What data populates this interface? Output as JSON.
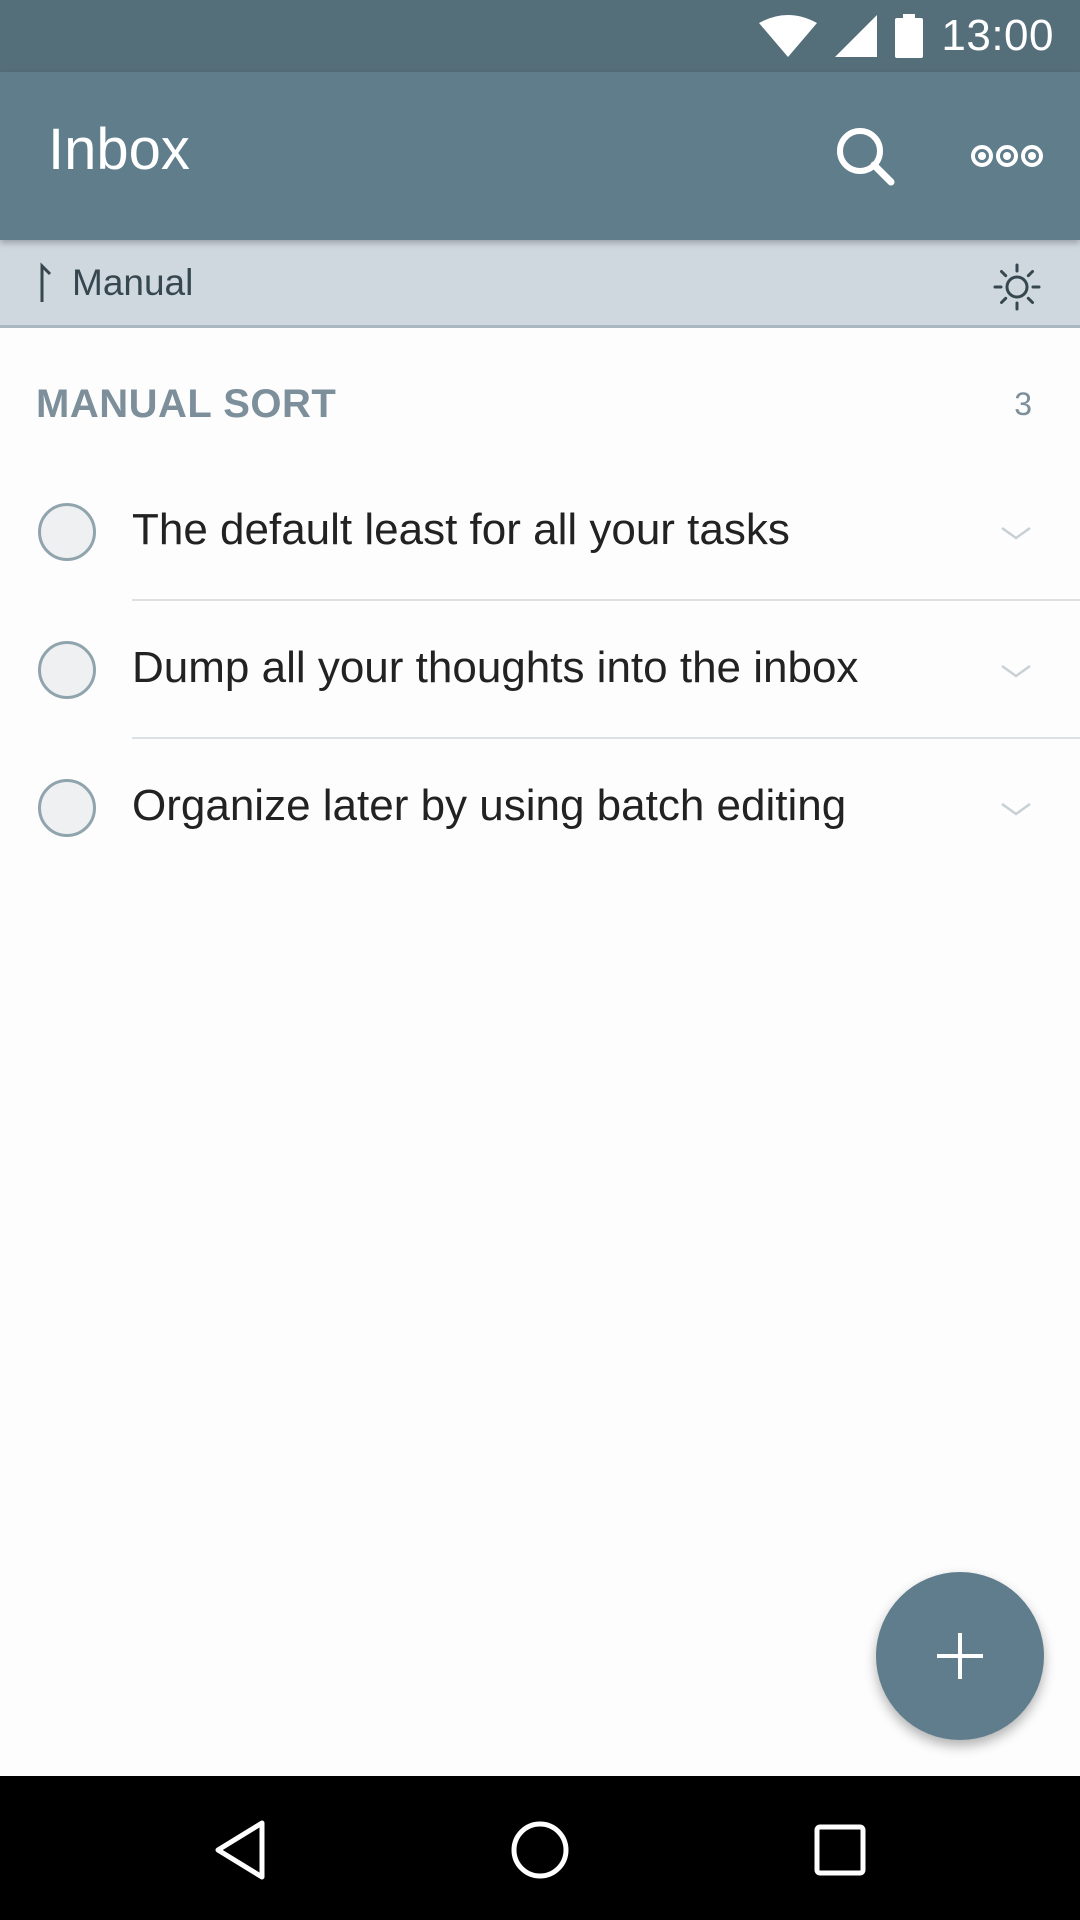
{
  "status_bar": {
    "time": "13:00",
    "icons": [
      "wifi-icon",
      "cell-signal-icon",
      "battery-icon"
    ]
  },
  "app_bar": {
    "title": "Inbox",
    "actions": [
      "search-icon",
      "more-options-icon"
    ]
  },
  "sort_bar": {
    "label": "Manual",
    "icons": [
      "sort-icon",
      "theme-sun-icon"
    ]
  },
  "section": {
    "title": "MANUAL SORT",
    "count": "3"
  },
  "tasks": [
    {
      "text": "The default least for all your tasks",
      "completed": false
    },
    {
      "text": "Dump all your thoughts into the inbox",
      "completed": false
    },
    {
      "text": "Organize later by using batch editing",
      "completed": false
    }
  ],
  "fab": {
    "icon": "plus-icon"
  },
  "nav_bar": {
    "buttons": [
      "back-icon",
      "home-icon",
      "recents-icon"
    ]
  },
  "colors": {
    "status_bar": "#546e7a",
    "app_bar": "#607d8b",
    "sort_bar": "#cfd8df",
    "accent": "#5f7d8c",
    "section_text": "#7c8f9b"
  }
}
